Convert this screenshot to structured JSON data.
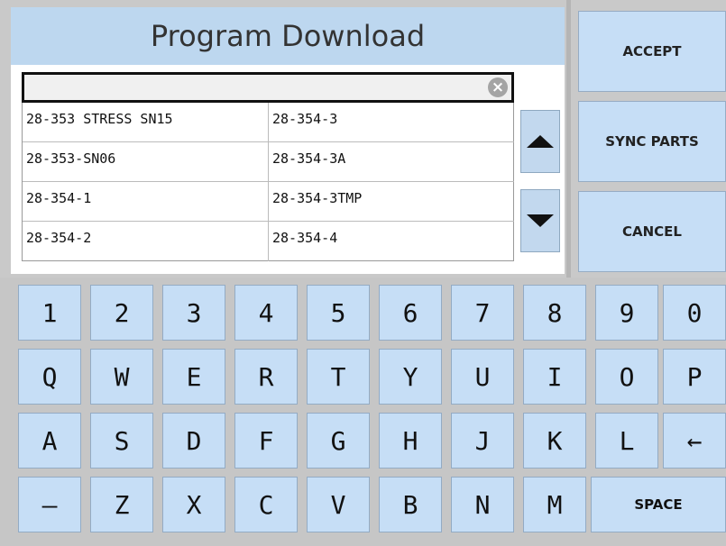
{
  "title": "Program Download",
  "search": {
    "value": "",
    "placeholder": ""
  },
  "programs": [
    [
      "28-353 STRESS SN15",
      "28-354-3"
    ],
    [
      "28-353-SN06",
      "28-354-3A"
    ],
    [
      "28-354-1",
      "28-354-3TMP"
    ],
    [
      "28-354-2",
      "28-354-4"
    ]
  ],
  "buttons": {
    "accept": "ACCEPT",
    "sync_parts": "SYNC PARTS",
    "cancel": "CANCEL"
  },
  "keyboard": {
    "row1": [
      "1",
      "2",
      "3",
      "4",
      "5",
      "6",
      "7",
      "8",
      "9",
      "0"
    ],
    "row2": [
      "Q",
      "W",
      "E",
      "R",
      "T",
      "Y",
      "U",
      "I",
      "O",
      "P"
    ],
    "row3": [
      "A",
      "S",
      "D",
      "F",
      "G",
      "H",
      "J",
      "K",
      "L",
      "←"
    ],
    "row4": [
      "–",
      "Z",
      "X",
      "C",
      "V",
      "B",
      "N",
      "M"
    ],
    "space": "SPACE"
  },
  "icons": {
    "clear": "clear-icon",
    "scroll_up": "triangle-up-icon",
    "scroll_down": "triangle-down-icon",
    "backspace": "backspace-arrow-icon"
  },
  "colors": {
    "title_bg": "#bdd7ef",
    "button_bg": "#c6def6",
    "background": "#c9c9c9"
  }
}
